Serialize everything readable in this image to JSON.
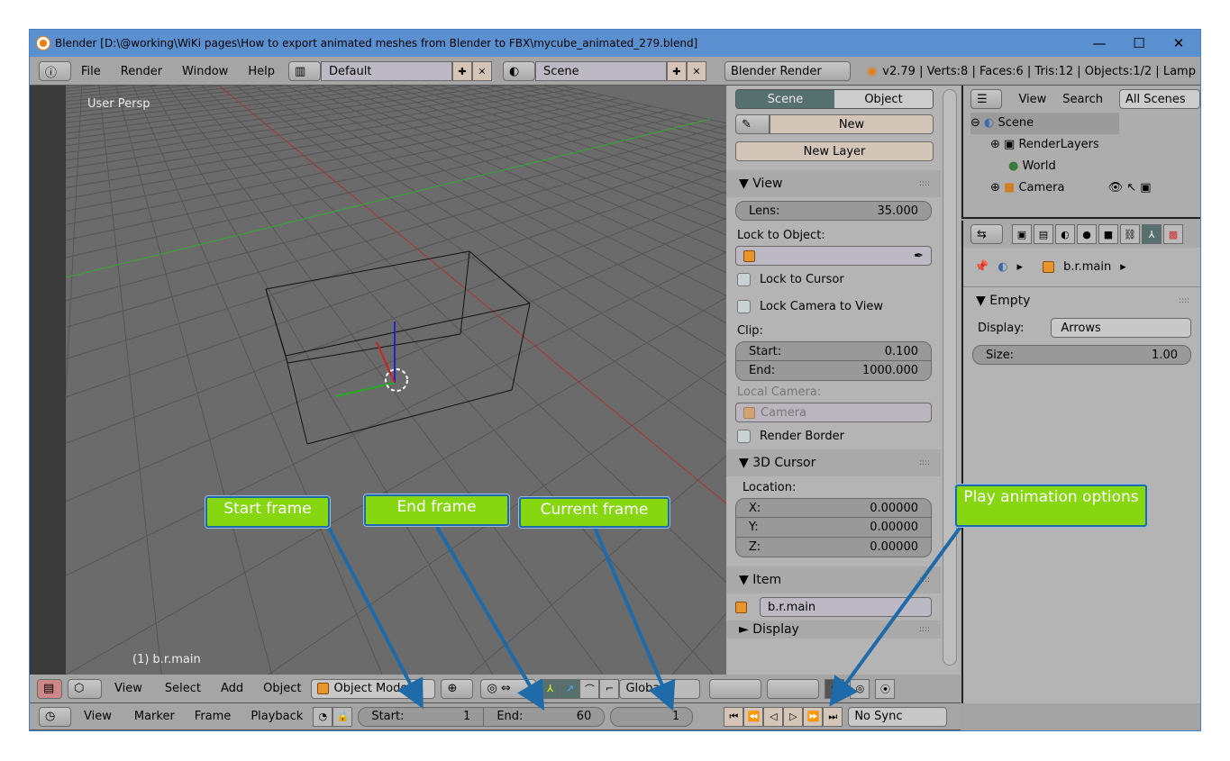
{
  "window": {
    "title": "Blender [D:\\@working\\WiKi pages\\How to export animated meshes from Blender to FBX\\mycube_animated_279.blend]",
    "minimize": "—",
    "maximize": "☐",
    "close": "✕"
  },
  "top_menu": {
    "items": [
      "File",
      "Render",
      "Window",
      "Help"
    ],
    "layout": "Default",
    "scene": "Scene",
    "engine": "Blender Render",
    "stats": "v2.79 | Verts:8 | Faces:6 | Tris:12 | Objects:1/2 | Lamp"
  },
  "viewport": {
    "label": "User Persp",
    "object_label": "(1) b.r.main",
    "axis_x": "x",
    "axis_y": "y",
    "axis_z": "z"
  },
  "npanel": {
    "tabs": [
      "Scene",
      "Object"
    ],
    "active_tab": "Scene",
    "new_label": "New",
    "new_layer": "New Layer",
    "view": {
      "title": "View",
      "lens_label": "Lens:",
      "lens": "35.000",
      "lock_object": "Lock to Object:",
      "lock_cursor": "Lock to Cursor",
      "lock_camera": "Lock Camera to View",
      "clip": "Clip:",
      "start_label": "Start:",
      "start": "0.100",
      "end_label": "End:",
      "end": "1000.000",
      "local_camera": "Local Camera:",
      "camera": "Camera",
      "render_border": "Render Border"
    },
    "cursor": {
      "title": "3D Cursor",
      "location": "Location:",
      "x_label": "X:",
      "x": "0.00000",
      "y_label": "Y:",
      "y": "0.00000",
      "z_label": "Z:",
      "z": "0.00000"
    },
    "item": {
      "title": "Item",
      "name": "b.r.main"
    },
    "display": {
      "title": "Display"
    }
  },
  "outliner": {
    "menu": [
      "View",
      "Search"
    ],
    "filter": "All Scenes",
    "tree": [
      "Scene",
      "RenderLayers",
      "World",
      "Camera"
    ]
  },
  "properties": {
    "breadcrumb": "b.r.main",
    "section": "Empty",
    "display_label": "Display:",
    "display_value": "Arrows",
    "size_label": "Size:",
    "size": "1.00"
  },
  "view3d_header": {
    "menus": [
      "View",
      "Select",
      "Add",
      "Object"
    ],
    "mode": "Object Mode",
    "orientation": "Global"
  },
  "timeline": {
    "menus": [
      "View",
      "Marker",
      "Frame",
      "Playback"
    ],
    "start_label": "Start:",
    "start": "1",
    "end_label": "End:",
    "end": "60",
    "current": "1",
    "sync": "No Sync",
    "play_buttons": [
      "⏮",
      "⏪",
      "◁",
      "▷",
      "⏩",
      "⏭"
    ]
  },
  "callouts": {
    "start": "Start frame",
    "end": "End frame",
    "current": "Current frame",
    "play": "Play animation options"
  },
  "colors": {
    "callout_bg": "#86d610",
    "callout_border": "#1f6aa8",
    "titlebar": "#5a8fd0"
  }
}
